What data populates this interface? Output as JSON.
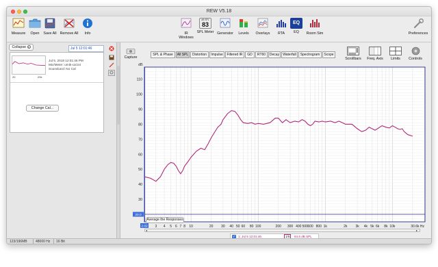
{
  "window": {
    "title": "REW V5.18"
  },
  "toolbar": {
    "left": [
      {
        "label": "Measure",
        "icon": "measure-icon"
      },
      {
        "label": "Open",
        "icon": "folder-icon"
      },
      {
        "label": "Save All",
        "icon": "save-icon"
      },
      {
        "label": "Remove All",
        "icon": "remove-icon"
      },
      {
        "label": "Info",
        "icon": "info-icon"
      }
    ],
    "center": [
      {
        "label": "IR Windows",
        "icon": "ir-windows-icon"
      },
      {
        "label": "SPL Meter",
        "icon": "spl-meter-icon"
      },
      {
        "label": "Generator",
        "icon": "generator-icon"
      },
      {
        "label": "Levels",
        "icon": "levels-icon"
      },
      {
        "label": "Overlays",
        "icon": "overlays-icon"
      },
      {
        "label": "RTA",
        "icon": "rta-icon"
      },
      {
        "label": "EQ",
        "icon": "eq-icon"
      },
      {
        "label": "Room Sim",
        "icon": "room-sim-icon"
      }
    ],
    "spl_meter": {
      "unit": "dB SPL",
      "value": "83"
    },
    "eq_badge": "EQ",
    "preferences": "Preferences"
  },
  "measurement_panel": {
    "collapse": "Collapse",
    "name": "Jul 5 12:01:46",
    "details": [
      "Jul 5, 2018 12:01:46 PM",
      "Mic/Meter: umik-cal.txt",
      "Soundcard: No Cal"
    ],
    "thumb_x_start": "20",
    "thumb_x_end": "20k",
    "change_cal": "Change Cal..."
  },
  "graph_panel": {
    "capture": "Capture",
    "tabs": [
      "SPL & Phase",
      "All SPL",
      "Distortion",
      "Impulse",
      "Filtered IR",
      "GD",
      "RT60",
      "Decay",
      "Waterfall",
      "Spectrogram",
      "Scope"
    ],
    "selected_tab": "All SPL",
    "right_buttons": [
      {
        "label": "Scrollbars",
        "icon": "scrollbars-icon"
      },
      {
        "label": "Freq. Axis",
        "icon": "freq-axis-icon"
      },
      {
        "label": "Limits",
        "icon": "limits-icon"
      },
      {
        "label": "Controls",
        "icon": "controls-icon"
      }
    ],
    "average_button": "Average the Responses",
    "legend": {
      "name": "1: Jul 5 12:01:46",
      "smoothing": "1/6",
      "value": "64.6 dB SPL"
    }
  },
  "chart_data": {
    "type": "line",
    "x_scale": "log",
    "ylabel": "dB",
    "xlim": [
      2.02,
      30600
    ],
    "ylim": [
      15,
      118
    ],
    "y_ticks": [
      20,
      30,
      40,
      50,
      60,
      70,
      80,
      90,
      100,
      110
    ],
    "x_ticks": [
      {
        "v": 2.02,
        "label": "2.02"
      },
      {
        "v": 3,
        "label": "3"
      },
      {
        "v": 4,
        "label": "4"
      },
      {
        "v": 5,
        "label": "5"
      },
      {
        "v": 6,
        "label": "6"
      },
      {
        "v": 7,
        "label": "7"
      },
      {
        "v": 8,
        "label": "8"
      },
      {
        "v": 10,
        "label": "10"
      },
      {
        "v": 20,
        "label": "20"
      },
      {
        "v": 30,
        "label": "30"
      },
      {
        "v": 40,
        "label": "40"
      },
      {
        "v": 50,
        "label": "50"
      },
      {
        "v": 60,
        "label": "60"
      },
      {
        "v": 80,
        "label": "80"
      },
      {
        "v": 100,
        "label": "100"
      },
      {
        "v": 200,
        "label": "200"
      },
      {
        "v": 300,
        "label": "300"
      },
      {
        "v": 400,
        "label": "400"
      },
      {
        "v": 500,
        "label": "500"
      },
      {
        "v": 600,
        "label": "600"
      },
      {
        "v": 800,
        "label": "800"
      },
      {
        "v": 1000,
        "label": "1k"
      },
      {
        "v": 2000,
        "label": "2k"
      },
      {
        "v": 3000,
        "label": "3k"
      },
      {
        "v": 4000,
        "label": "4k"
      },
      {
        "v": 5000,
        "label": "5k"
      },
      {
        "v": 6000,
        "label": "6k"
      },
      {
        "v": 8000,
        "label": "8k"
      },
      {
        "v": 10000,
        "label": "10k"
      },
      {
        "v": 30600,
        "label": "30.6k Hz"
      }
    ],
    "cursor": {
      "x": 2.02,
      "y_label": "20.0"
    },
    "reference_level": 20,
    "series": [
      {
        "name": "1: Jul 5 12:01:46",
        "color": "#b0287a",
        "points": [
          [
            2.02,
            45
          ],
          [
            2.5,
            44
          ],
          [
            3,
            42
          ],
          [
            3.5,
            45
          ],
          [
            4,
            50
          ],
          [
            4.5,
            53
          ],
          [
            5,
            54.5
          ],
          [
            5.5,
            54
          ],
          [
            6,
            52
          ],
          [
            6.5,
            49
          ],
          [
            7,
            47
          ],
          [
            7.5,
            49
          ],
          [
            8,
            52
          ],
          [
            9,
            55
          ],
          [
            10,
            58
          ],
          [
            12,
            62
          ],
          [
            14,
            64
          ],
          [
            16,
            63
          ],
          [
            18,
            67
          ],
          [
            20,
            71
          ],
          [
            22,
            74
          ],
          [
            25,
            78
          ],
          [
            28,
            80
          ],
          [
            30,
            83
          ],
          [
            35,
            87
          ],
          [
            40,
            89
          ],
          [
            45,
            88.5
          ],
          [
            50,
            86
          ],
          [
            55,
            83
          ],
          [
            60,
            81
          ],
          [
            70,
            80.5
          ],
          [
            80,
            81
          ],
          [
            90,
            80
          ],
          [
            100,
            80.5
          ],
          [
            120,
            80
          ],
          [
            150,
            81
          ],
          [
            180,
            84
          ],
          [
            200,
            84
          ],
          [
            230,
            81
          ],
          [
            260,
            83
          ],
          [
            300,
            81
          ],
          [
            350,
            82
          ],
          [
            400,
            81.5
          ],
          [
            450,
            83
          ],
          [
            500,
            82
          ],
          [
            550,
            80
          ],
          [
            600,
            79
          ],
          [
            650,
            80
          ],
          [
            700,
            82
          ],
          [
            800,
            81.5
          ],
          [
            900,
            82
          ],
          [
            1000,
            81.5
          ],
          [
            1200,
            82
          ],
          [
            1400,
            81
          ],
          [
            1600,
            82
          ],
          [
            1800,
            81
          ],
          [
            2000,
            80
          ],
          [
            2500,
            80
          ],
          [
            3000,
            77
          ],
          [
            3500,
            75
          ],
          [
            4000,
            76
          ],
          [
            4500,
            78
          ],
          [
            5000,
            77
          ],
          [
            5500,
            76
          ],
          [
            6000,
            77
          ],
          [
            7000,
            79
          ],
          [
            8000,
            78
          ],
          [
            9000,
            77.5
          ],
          [
            10000,
            79
          ],
          [
            11000,
            78
          ],
          [
            12000,
            77
          ],
          [
            13000,
            76.5
          ],
          [
            14000,
            77
          ],
          [
            15000,
            75
          ],
          [
            17000,
            73
          ],
          [
            20000,
            72
          ]
        ]
      }
    ],
    "thumbnail": [
      [
        20,
        72
      ],
      [
        35,
        78
      ],
      [
        80,
        73
      ],
      [
        200,
        75
      ],
      [
        500,
        72
      ],
      [
        1000,
        74
      ],
      [
        3000,
        70
      ],
      [
        20000,
        69
      ]
    ]
  },
  "statusbar": {
    "memory": "123/196MB",
    "rate": "48000 Hz",
    "bits": "16 Bit"
  },
  "colors": {
    "trace": "#b0287a",
    "plot_border": "#2b2b8a",
    "selection": "#3d6fd8"
  }
}
